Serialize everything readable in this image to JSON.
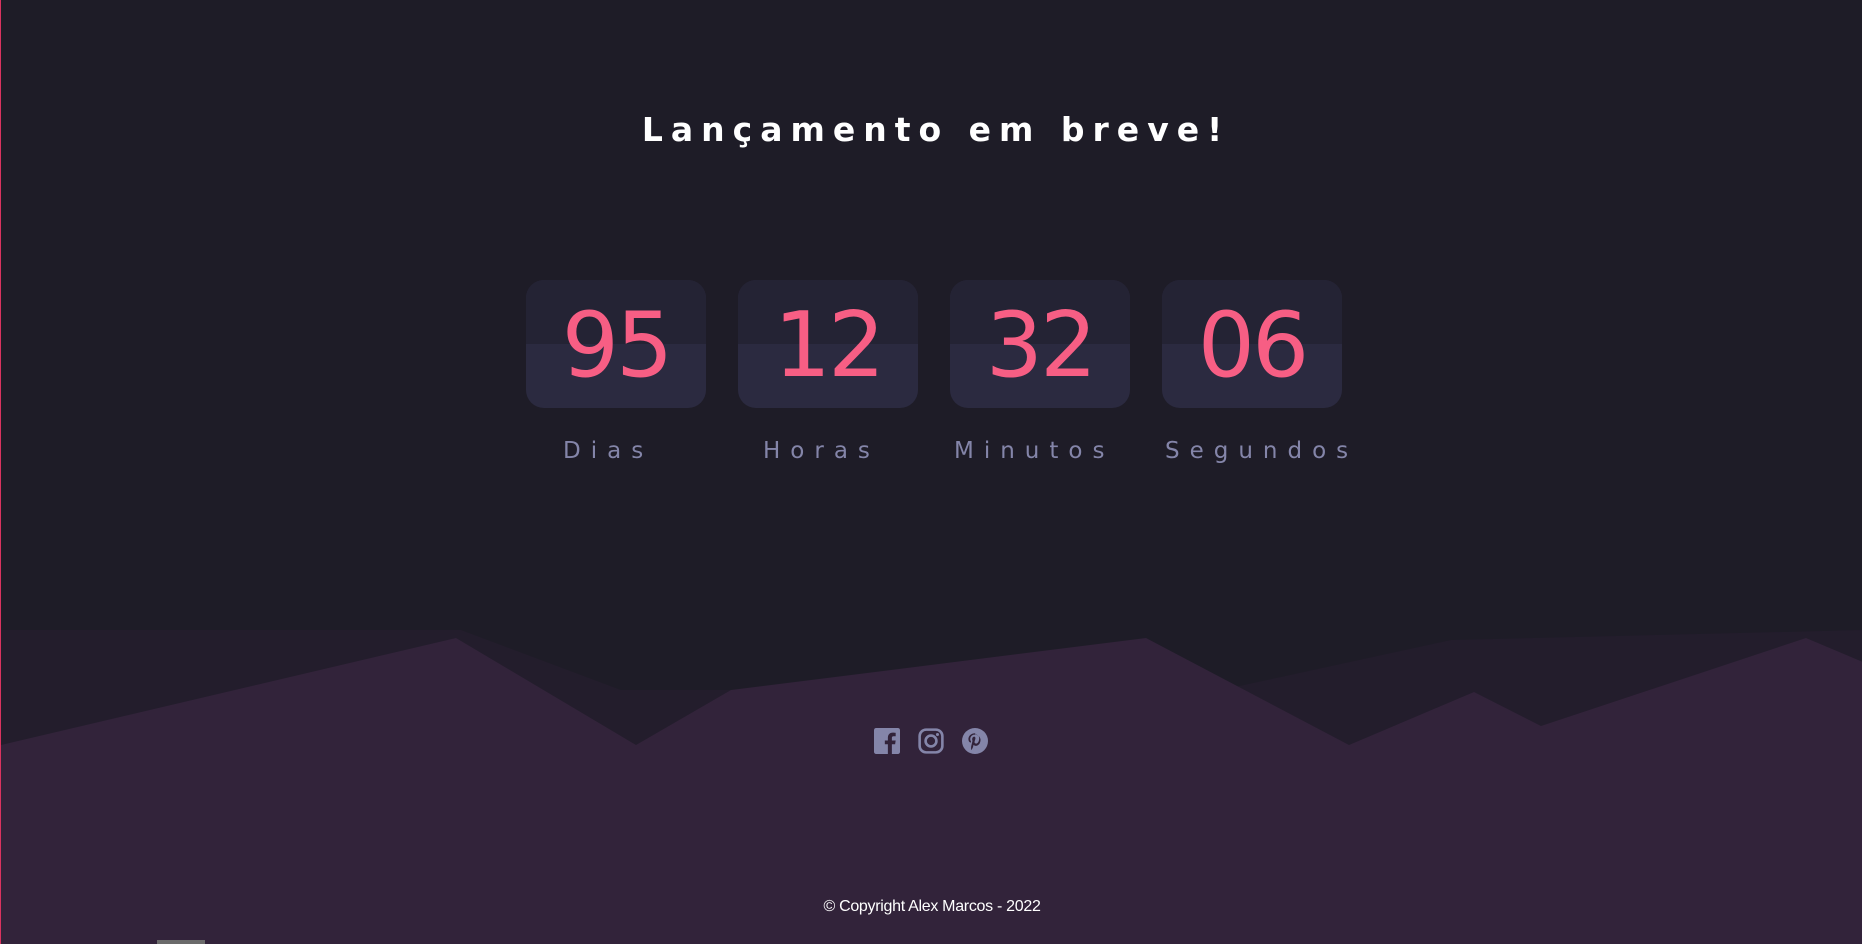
{
  "heading": "Lançamento em breve!",
  "countdown": [
    {
      "value": "95",
      "label": "Dias"
    },
    {
      "value": "12",
      "label": "Horas"
    },
    {
      "value": "32",
      "label": "Minutos"
    },
    {
      "value": "06",
      "label": "Segundos"
    }
  ],
  "social": [
    {
      "name": "facebook",
      "icon": "facebook-icon"
    },
    {
      "name": "instagram",
      "icon": "instagram-icon"
    },
    {
      "name": "pinterest",
      "icon": "pinterest-icon"
    }
  ],
  "footer": {
    "copyright": "© Copyright Alex Marcos - 2022"
  },
  "colors": {
    "background": "#1e1c27",
    "hills": "#32233a",
    "accent": "#f75e84",
    "label": "#8485a9",
    "card": "#2b2a40"
  }
}
